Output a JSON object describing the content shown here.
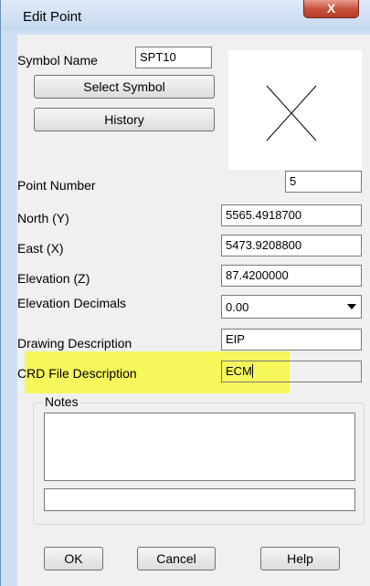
{
  "window": {
    "title": "Edit Point",
    "close_glyph": "X"
  },
  "symbol": {
    "name_label": "Symbol Name",
    "name_value": "SPT10",
    "select_button": "Select Symbol",
    "history_button": "History",
    "preview_icon": "x-cross-symbol"
  },
  "fields": {
    "point_number": {
      "label": "Point Number",
      "value": "5"
    },
    "north": {
      "label": "North (Y)",
      "value": "5565.4918700"
    },
    "east": {
      "label": "East (X)",
      "value": "5473.9208800"
    },
    "elevation": {
      "label": "Elevation (Z)",
      "value": "87.4200000"
    },
    "elevation_decimals": {
      "label": "Elevation Decimals",
      "value": "0.00"
    },
    "drawing_description": {
      "label": "Drawing Description",
      "value": "EIP"
    },
    "crd_file_description": {
      "label": "CRD File Description",
      "value": "ECM"
    }
  },
  "notes": {
    "legend": "Notes",
    "text": "",
    "line": ""
  },
  "buttons": {
    "ok": "OK",
    "cancel": "Cancel",
    "help": "Help"
  },
  "colors": {
    "highlight": "#f6f75a",
    "titlebar": "#c5d8ef",
    "close": "#c8513c"
  }
}
